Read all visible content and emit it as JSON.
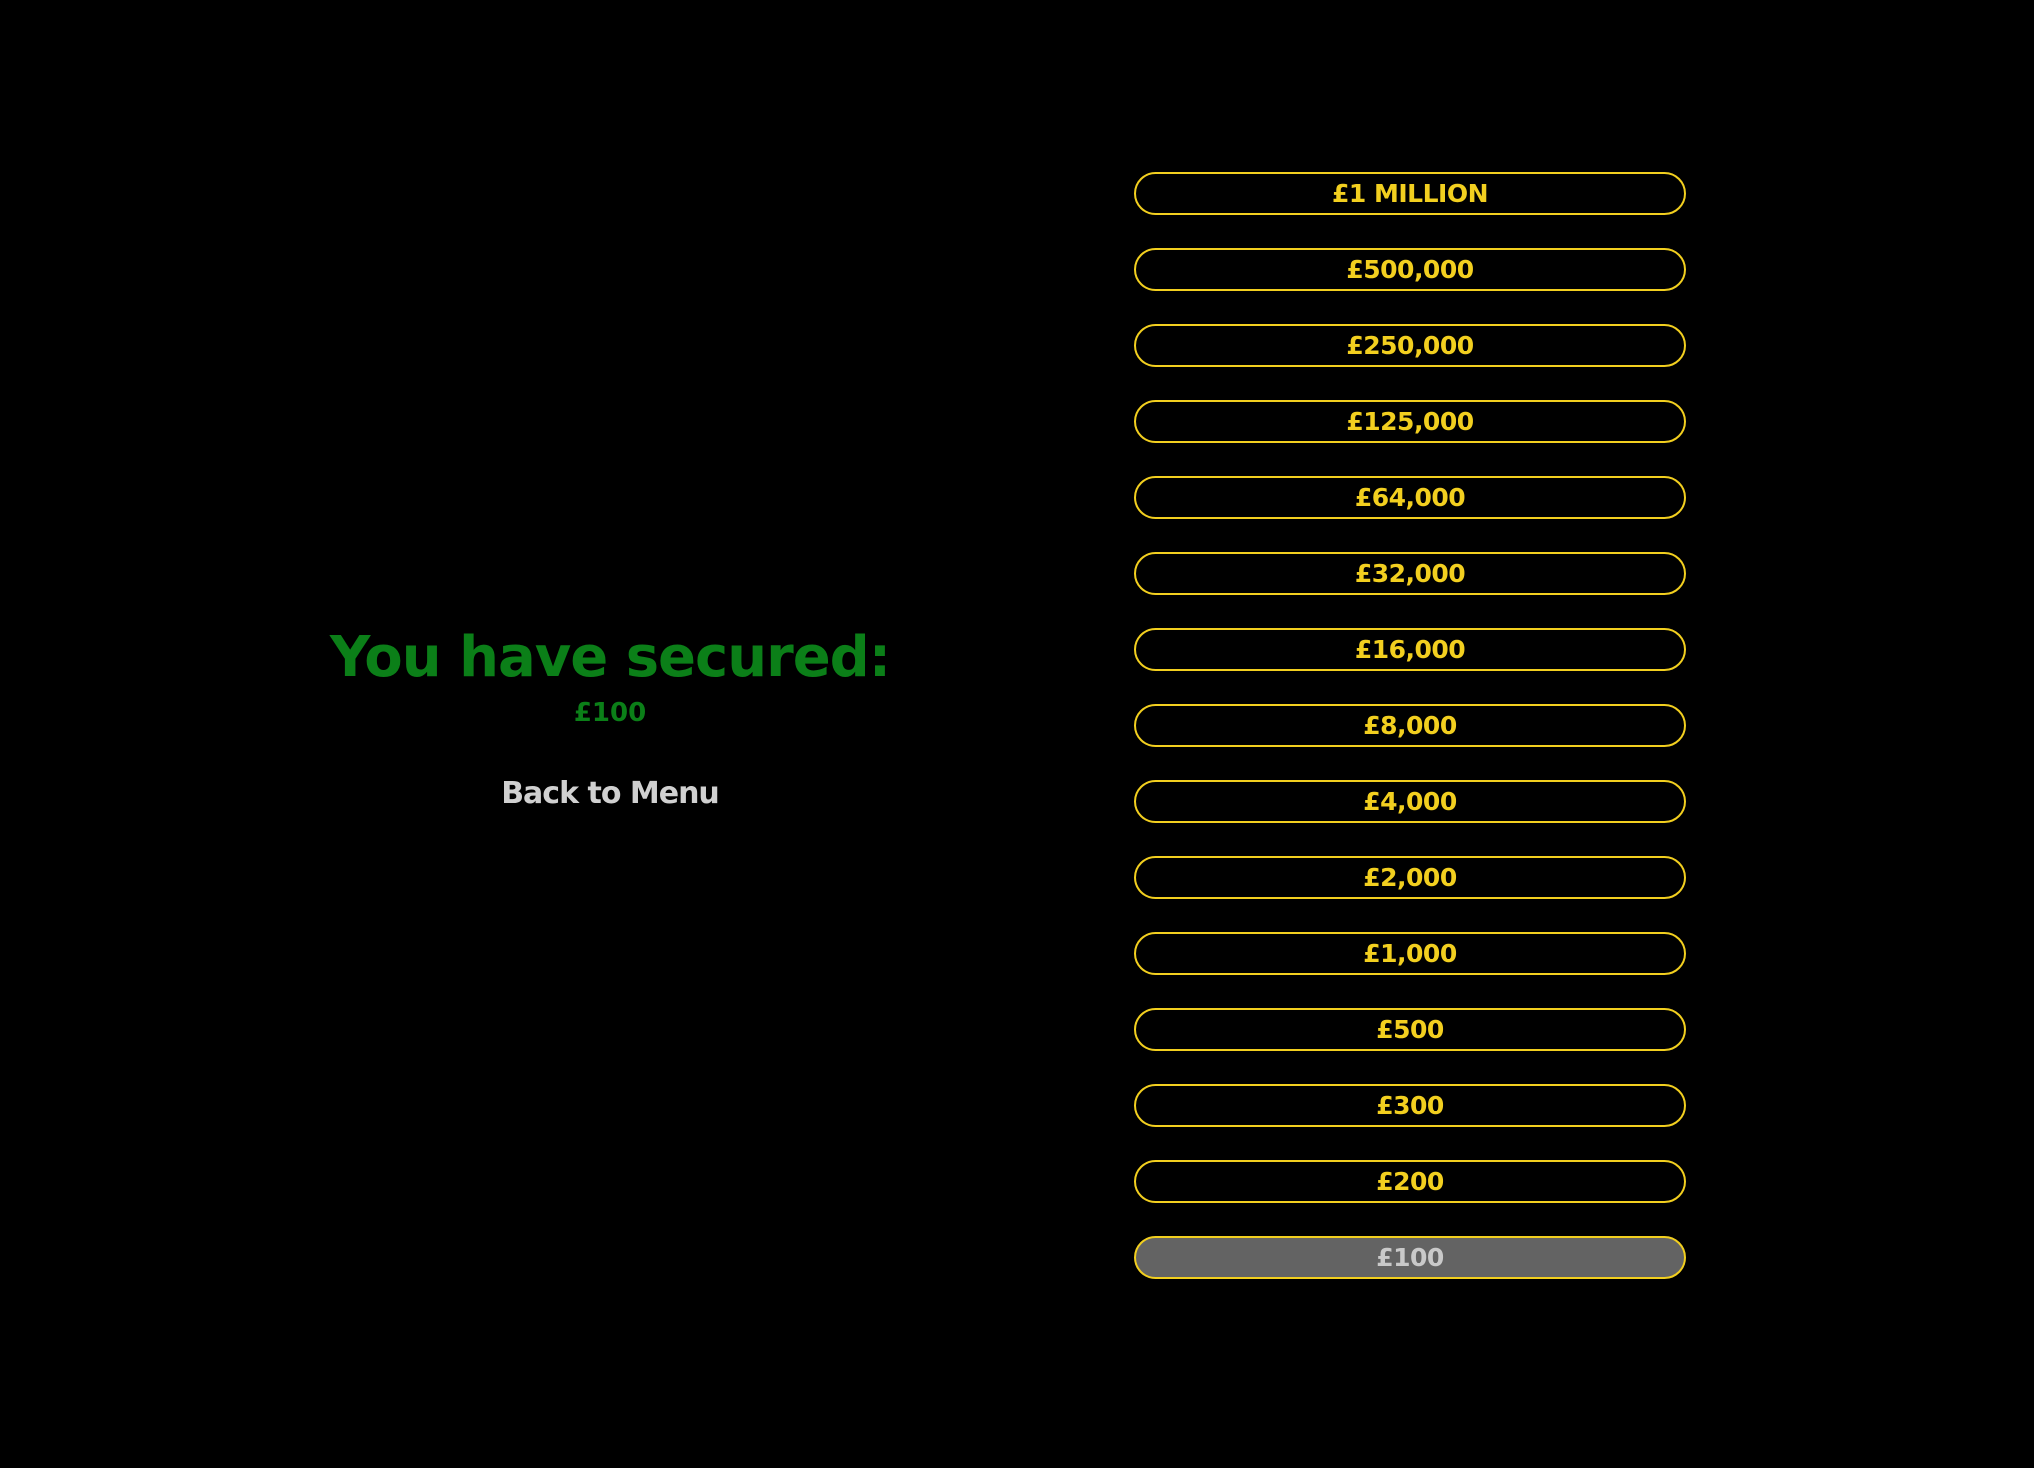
{
  "result": {
    "heading": "You have secured:",
    "amount": "£100",
    "back_label": "Back to Menu"
  },
  "colors": {
    "background": "#000000",
    "secured_text": "#0b7f18",
    "back_text": "#d0d0d0",
    "ladder_border": "#f2cf1f",
    "ladder_text": "#f2cf1f",
    "current_fill": "#636363",
    "current_text": "#c9c9c9"
  },
  "prize_ladder": [
    {
      "label": "£1 MILLION",
      "current": false
    },
    {
      "label": "£500,000",
      "current": false
    },
    {
      "label": "£250,000",
      "current": false
    },
    {
      "label": "£125,000",
      "current": false
    },
    {
      "label": "£64,000",
      "current": false
    },
    {
      "label": "£32,000",
      "current": false
    },
    {
      "label": "£16,000",
      "current": false
    },
    {
      "label": "£8,000",
      "current": false
    },
    {
      "label": "£4,000",
      "current": false
    },
    {
      "label": "£2,000",
      "current": false
    },
    {
      "label": "£1,000",
      "current": false
    },
    {
      "label": "£500",
      "current": false
    },
    {
      "label": "£300",
      "current": false
    },
    {
      "label": "£200",
      "current": false
    },
    {
      "label": "£100",
      "current": true
    }
  ]
}
